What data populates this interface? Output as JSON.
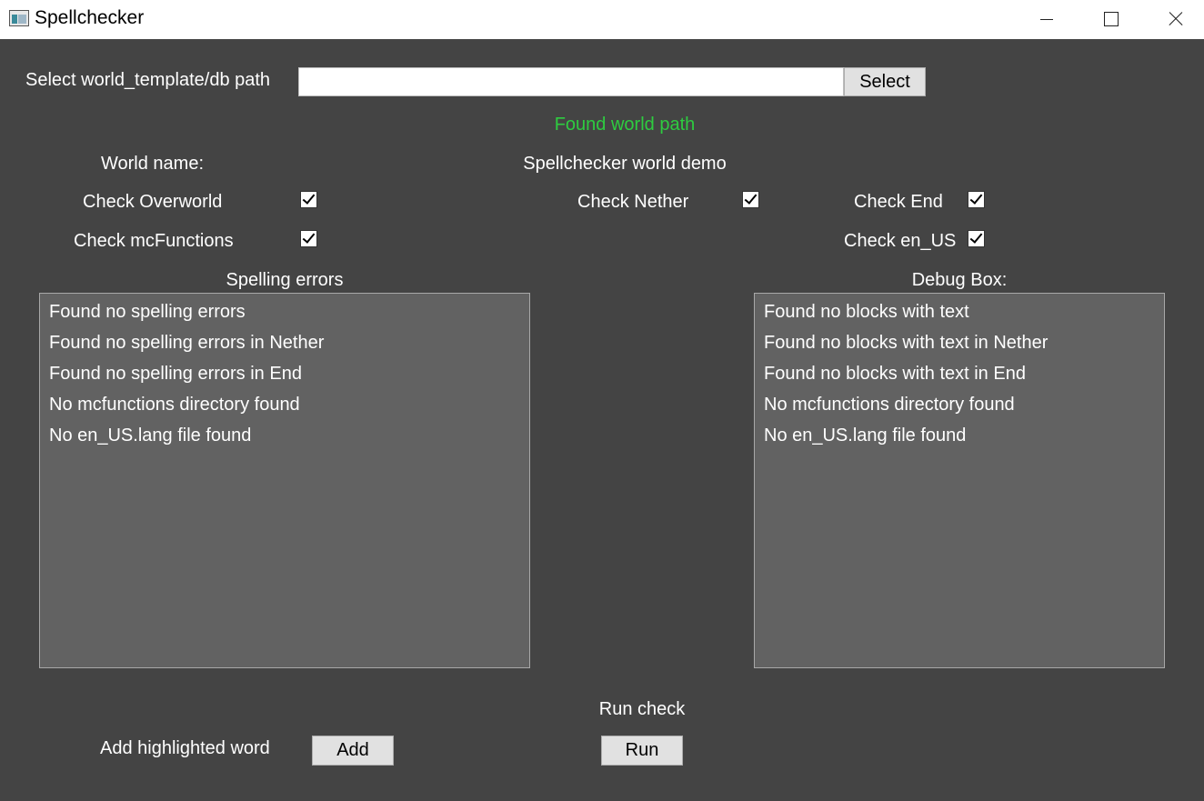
{
  "window": {
    "title": "Spellchecker",
    "app_icon": "app-window-icon"
  },
  "path_section": {
    "label": "Select world_template/db path",
    "input_value": "",
    "select_button": "Select",
    "status": "Found world path",
    "status_color": "#2ecc40"
  },
  "world": {
    "name_label": "World name:",
    "name_value": "Spellchecker world demo"
  },
  "checks": {
    "overworld": {
      "label": "Check Overworld",
      "checked": true
    },
    "nether": {
      "label": "Check Nether",
      "checked": true
    },
    "end": {
      "label": "Check End",
      "checked": true
    },
    "mcfunctions": {
      "label": "Check mcFunctions",
      "checked": true
    },
    "en_us": {
      "label": "Check en_US",
      "checked": true
    }
  },
  "spelling": {
    "title": "Spelling errors",
    "items": [
      "Found no spelling errors",
      "Found no spelling errors in Nether",
      "Found no spelling errors in End",
      "No mcfunctions directory found",
      "No en_US.lang file found"
    ]
  },
  "debug": {
    "title": "Debug Box:",
    "items": [
      "Found no blocks with text",
      "Found no blocks with text in Nether",
      "Found no blocks with text in End",
      "No mcfunctions directory found",
      "No en_US.lang file found"
    ]
  },
  "actions": {
    "add_label": "Add highlighted word",
    "add_button": "Add",
    "run_label": "Run check",
    "run_button": "Run"
  },
  "colors": {
    "background": "#444444",
    "list_background": "#626262",
    "status_green": "#2ecc40"
  }
}
